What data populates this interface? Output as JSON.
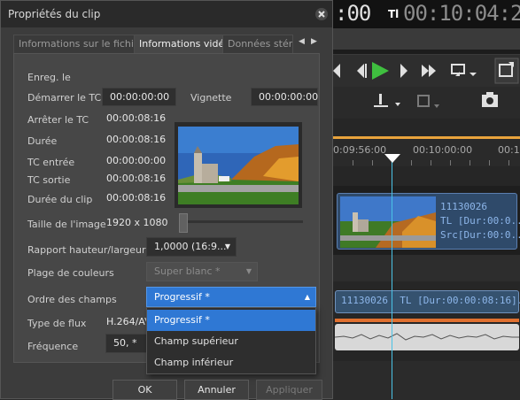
{
  "editor": {
    "timecode_left": ":00",
    "timecode_tl": "Tl",
    "timecode_right": "00:10:04:24",
    "ruler": [
      "0:09:56:00",
      "00:10:00:00",
      "00:10"
    ],
    "video_clip": {
      "name": "11130026",
      "line2": "TL [Dur:00:0...",
      "line3": "Src[Dur:00:0..."
    },
    "audio_clip": {
      "name": "11130026",
      "detail": "TL [Dur:00:00:08:16]",
      "tail": "..."
    },
    "colors": {
      "accent_play": "#3fbf3f",
      "playhead": "#4ac3e6",
      "audio_line": "#e07030",
      "ruler_bar": "#e8a33c"
    }
  },
  "dialog": {
    "title": "Propriétés du clip",
    "tabs": [
      {
        "label": "Informations sur le fichier",
        "active": false
      },
      {
        "label": "Informations vidéo",
        "active": true
      },
      {
        "label": "Données stéréo",
        "active": false
      }
    ],
    "fields": {
      "enreg_le_label": "Enreg. le",
      "demarrer_tc_label": "Démarrer le TC",
      "demarrer_tc_value": "00:00:00:00",
      "vignette_label": "Vignette",
      "vignette_value": "00:00:00:00",
      "arreter_tc_label": "Arrêter le TC",
      "arreter_tc_value": "00:00:08:16",
      "duree_label": "Durée",
      "duree_value": "00:00:08:16",
      "tc_entree_label": "TC entrée",
      "tc_entree_value": "00:00:00:00",
      "tc_sortie_label": "TC sortie",
      "tc_sortie_value": "00:00:08:16",
      "duree_clip_label": "Durée du clip",
      "duree_clip_value": "00:00:08:16",
      "taille_label": "Taille de l'image",
      "taille_value": "1920 x 1080",
      "rapport_label": "Rapport hauteur/largeur",
      "rapport_value": "1,0000 (16:9...",
      "plage_label": "Plage de couleurs",
      "plage_value": "Super blanc *",
      "ordre_label": "Ordre des champs",
      "ordre_value": "Progressif *",
      "type_flux_label": "Type de flux",
      "type_flux_value": "H.264/AV",
      "frequence_label": "Fréquence",
      "frequence_value": "50, *"
    },
    "dropdown_options": [
      "Progressif *",
      "Champ supérieur",
      "Champ inférieur"
    ],
    "buttons": {
      "ok": "OK",
      "cancel": "Annuler",
      "apply": "Appliquer"
    }
  }
}
